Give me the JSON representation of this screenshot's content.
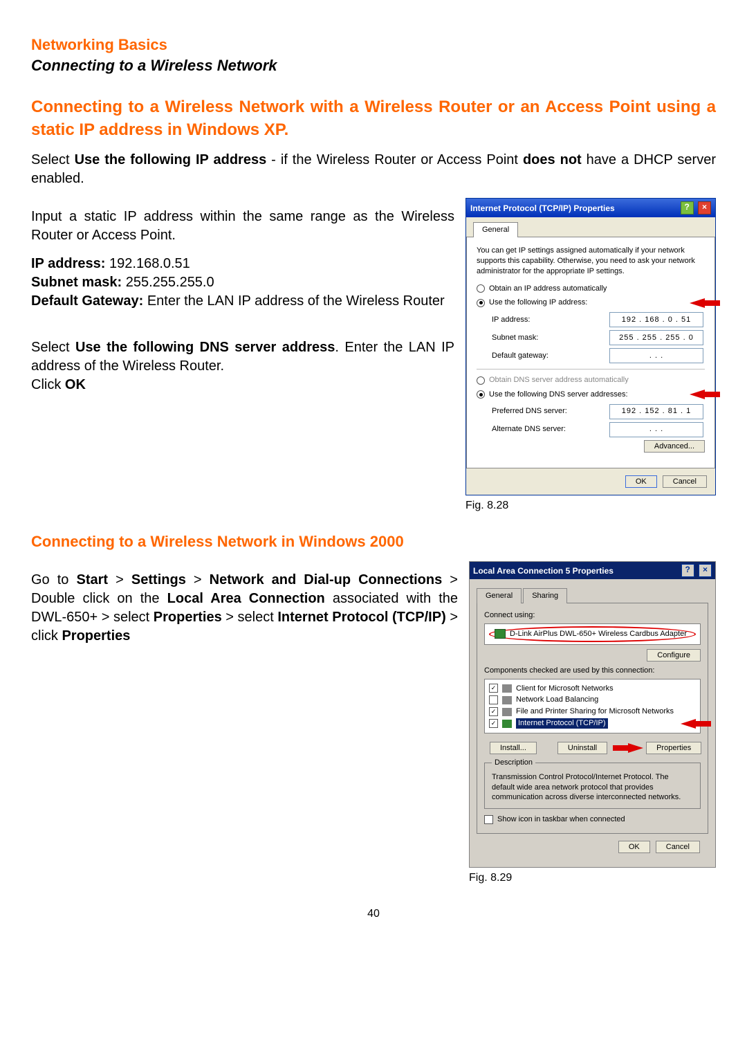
{
  "pageNumber": "40",
  "header": {
    "title": "Networking Basics",
    "subtitle": "Connecting to a Wireless Network"
  },
  "section1": {
    "title": "Connecting to a Wireless Network with a Wireless Router or an Access Point using a static IP address in Windows XP.",
    "para1_a": "Select ",
    "para1_b": "Use the following IP address",
    "para1_c": " - if the Wireless Router or Access Point ",
    "para1_d": "does not",
    "para1_e": " have a DHCP server enabled.",
    "para2": "Input a static IP address within the same range as the Wireless Router or Access Point.",
    "ip_label": "IP address:",
    "ip_value": " 192.168.0.51",
    "subnet_label": "Subnet mask:",
    "subnet_value": " 255.255.255.0",
    "gateway_label": "Default Gateway:",
    "gateway_value": " Enter the LAN IP address of the Wireless Router",
    "para3_a": "Select ",
    "para3_b": "Use the following DNS server address",
    "para3_c": ". Enter the LAN IP address of the Wireless Router.",
    "para4_a": "Click ",
    "para4_b": "OK",
    "figcaption": "Fig. 8.28"
  },
  "dialog1": {
    "title": "Internet Protocol (TCP/IP) Properties",
    "tab": "General",
    "intro": "You can get IP settings assigned automatically if your network supports this capability. Otherwise, you need to ask your network administrator for the appropriate IP settings.",
    "radio_auto": "Obtain an IP address automatically",
    "radio_manual": "Use the following IP address:",
    "ip_label": "IP address:",
    "ip_value": "192 . 168 .   0  .  51",
    "mask_label": "Subnet mask:",
    "mask_value": "255 . 255 . 255 .   0",
    "gw_label": "Default gateway:",
    "gw_value": ".       .       .",
    "dns_auto": "Obtain DNS server address automatically",
    "dns_manual": "Use the following DNS server addresses:",
    "pdns_label": "Preferred DNS server:",
    "pdns_value": "192 . 152 .  81  .   1",
    "adns_label": "Alternate DNS server:",
    "adns_value": ".       .       .",
    "advanced": "Advanced...",
    "ok": "OK",
    "cancel": "Cancel"
  },
  "section2": {
    "title": "Connecting to a Wireless Network in Windows 2000",
    "p_a": "Go to ",
    "p_b": "Start",
    "p_c": " > ",
    "p_d": "Settings",
    "p_e": " > ",
    "p_f": "Network and Dial-up Connections",
    "p_g": " > Double click on the ",
    "p_h": "Local Area Connection",
    "p_i": " associated with the DWL-650+ > select ",
    "p_j": "Properties",
    "p_k": " > select ",
    "p_l": "Internet Protocol (TCP/IP)",
    "p_m": " > click ",
    "p_n": "Properties",
    "figcaption": "Fig. 8.29"
  },
  "dialog2": {
    "title": "Local Area Connection 5 Properties",
    "tab1": "General",
    "tab2": "Sharing",
    "connect_using": "Connect using:",
    "adapter": "D-Link AirPlus DWL-650+ Wireless Cardbus Adapter",
    "configure": "Configure",
    "components_label": "Components checked are used by this connection:",
    "c1": "Client for Microsoft Networks",
    "c2": "Network Load Balancing",
    "c3": "File and Printer Sharing for Microsoft Networks",
    "c4": "Internet Protocol (TCP/IP)",
    "install": "Install...",
    "uninstall": "Uninstall",
    "properties": "Properties",
    "desc_title": "Description",
    "desc_body": "Transmission Control Protocol/Internet Protocol. The default wide area network protocol that provides communication across diverse interconnected networks.",
    "show_icon": "Show icon in taskbar when connected",
    "ok": "OK",
    "cancel": "Cancel"
  }
}
